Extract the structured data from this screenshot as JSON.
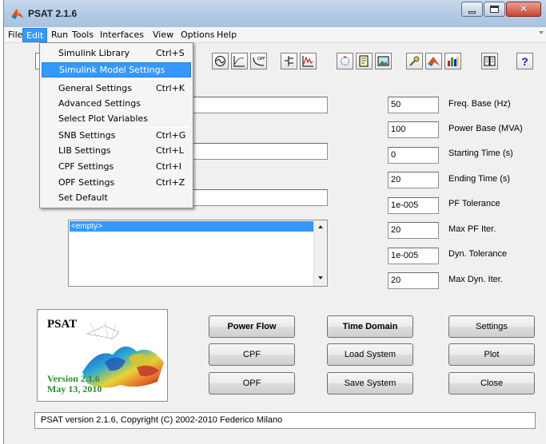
{
  "window": {
    "title": "PSAT 2.1.6"
  },
  "menubar": {
    "items": [
      {
        "label": "File"
      },
      {
        "label": "Edit"
      },
      {
        "label": "Run"
      },
      {
        "label": "Tools"
      },
      {
        "label": "Interfaces"
      },
      {
        "label": "View"
      },
      {
        "label": "Options"
      },
      {
        "label": "Help"
      }
    ],
    "active": "Edit"
  },
  "edit_menu": {
    "items": [
      {
        "label": "Simulink Library",
        "shortcut": "Ctrl+S"
      },
      {
        "label": "Simulink Model Settings",
        "shortcut": ""
      },
      {
        "label": "General Settings",
        "shortcut": "Ctrl+K"
      },
      {
        "label": "Advanced Settings",
        "shortcut": ""
      },
      {
        "label": "Select Plot Variables",
        "shortcut": ""
      },
      {
        "label": "SNB Settings",
        "shortcut": "Ctrl+G"
      },
      {
        "label": "LIB Settings",
        "shortcut": "Ctrl+L"
      },
      {
        "label": "CPF Settings",
        "shortcut": "Ctrl+I"
      },
      {
        "label": "OPF Settings",
        "shortcut": "Ctrl+Z"
      },
      {
        "label": "Set Default",
        "shortcut": ""
      }
    ],
    "highlighted": "Simulink Model Settings"
  },
  "toolbar": {
    "icons": [
      "sine-wave-icon",
      "bode-plot-icon",
      "opf-icon",
      "bus-diagram-icon",
      "waveform-icon",
      "cycle-icon",
      "document-icon",
      "image-icon",
      "tools-icon",
      "matlab-icon",
      "bar-chart-icon",
      "book-icon",
      "help-icon"
    ],
    "help_glyph": "?"
  },
  "settings": {
    "freq_base": {
      "value": "50",
      "label": "Freq. Base (Hz)"
    },
    "power_base": {
      "value": "100",
      "label": "Power Base (MVA)"
    },
    "start_time": {
      "value": "0",
      "label": "Starting Time (s)"
    },
    "end_time": {
      "value": "20",
      "label": "Ending Time (s)"
    },
    "pf_tol": {
      "value": "1e-005",
      "label": "PF Tolerance"
    },
    "max_pf_iter": {
      "value": "20",
      "label": "Max PF Iter."
    },
    "dyn_tol": {
      "value": "1e-005",
      "label": "Dyn. Tolerance"
    },
    "max_dyn_iter": {
      "value": "20",
      "label": "Max Dyn. Iter."
    }
  },
  "plot_list": {
    "items": [
      "<empty>"
    ]
  },
  "logo": {
    "title": "PSAT",
    "version": "Version 2.1.6",
    "date": "May 13, 2010"
  },
  "buttons": {
    "power_flow": "Power Flow",
    "time_domain": "Time Domain",
    "settings": "Settings",
    "cpf": "CPF",
    "load_system": "Load System",
    "plot": "Plot",
    "opf": "OPF",
    "save_system": "Save System",
    "close": "Close"
  },
  "status": {
    "text": "PSAT version 2.1.6, Copyright (C) 2002-2010 Federico Milano"
  },
  "colors": {
    "accent": "#3399ff",
    "logo_version": "#2e8b2e",
    "titlebar": "#b6cce5"
  }
}
